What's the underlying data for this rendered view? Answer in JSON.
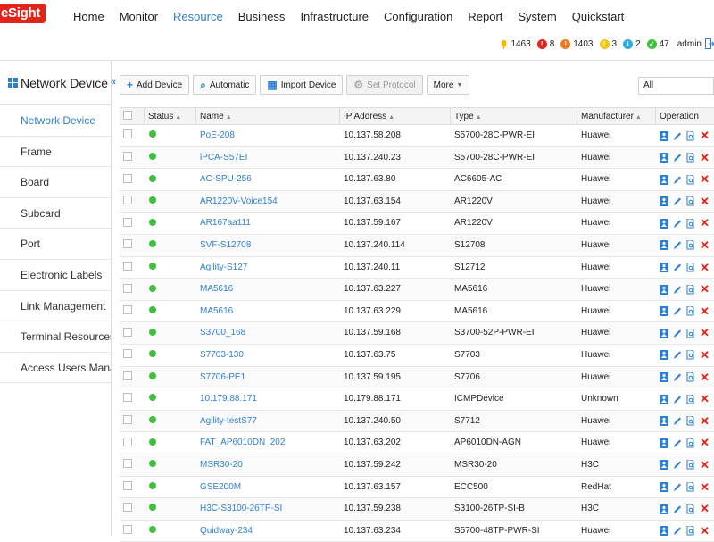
{
  "app": {
    "logo_text": "eSight",
    "nav": [
      {
        "label": "Home",
        "active": false
      },
      {
        "label": "Monitor",
        "active": false
      },
      {
        "label": "Resource",
        "active": true
      },
      {
        "label": "Business",
        "active": false
      },
      {
        "label": "Infrastructure",
        "active": false
      },
      {
        "label": "Configuration",
        "active": false
      },
      {
        "label": "Report",
        "active": false
      },
      {
        "label": "System",
        "active": false
      },
      {
        "label": "Quickstart",
        "active": false
      }
    ],
    "alarms": {
      "total": "1463",
      "critical": "8",
      "major": "1403",
      "minor": "3",
      "warning": "2",
      "cleared": "47"
    },
    "user": "admin"
  },
  "sidebar": {
    "title": "Network Device",
    "collapse_icon": "«",
    "items": [
      {
        "label": "Network Device",
        "active": true
      },
      {
        "label": "Frame",
        "active": false
      },
      {
        "label": "Board",
        "active": false
      },
      {
        "label": "Subcard",
        "active": false
      },
      {
        "label": "Port",
        "active": false
      },
      {
        "label": "Electronic Labels",
        "active": false
      },
      {
        "label": "Link Management",
        "active": false
      },
      {
        "label": "Terminal Resources",
        "active": false
      },
      {
        "label": "Access Users Manage...",
        "active": false
      }
    ]
  },
  "toolbar": {
    "add_device": "Add Device",
    "automatic": "Automatic",
    "import_device": "Import Device",
    "set_protocol": "Set Protocol",
    "more": "More",
    "filter_value": "All"
  },
  "table": {
    "headers": {
      "status": "Status",
      "name": "Name",
      "ip": "IP Address",
      "type": "Type",
      "manufacturer": "Manufacturer",
      "operation": "Operation"
    },
    "rows": [
      {
        "name": "PoE-208",
        "ip": "10.137.58.208",
        "type": "S5700-28C-PWR-EI",
        "manufacturer": "Huawei"
      },
      {
        "name": "iPCA-S57EI",
        "ip": "10.137.240.23",
        "type": "S5700-28C-PWR-EI",
        "manufacturer": "Huawei"
      },
      {
        "name": "AC-SPU-256",
        "ip": "10.137.63.80",
        "type": "AC6605-AC",
        "manufacturer": "Huawei"
      },
      {
        "name": "AR1220V-Voice154",
        "ip": "10.137.63.154",
        "type": "AR1220V",
        "manufacturer": "Huawei"
      },
      {
        "name": "AR167aa111",
        "ip": "10.137.59.167",
        "type": "AR1220V",
        "manufacturer": "Huawei"
      },
      {
        "name": "SVF-S12708",
        "ip": "10.137.240.114",
        "type": "S12708",
        "manufacturer": "Huawei"
      },
      {
        "name": "Agility-S127",
        "ip": "10.137.240.11",
        "type": "S12712",
        "manufacturer": "Huawei"
      },
      {
        "name": "MA5616",
        "ip": "10.137.63.227",
        "type": "MA5616",
        "manufacturer": "Huawei"
      },
      {
        "name": "MA5616",
        "ip": "10.137.63.229",
        "type": "MA5616",
        "manufacturer": "Huawei"
      },
      {
        "name": "S3700_168",
        "ip": "10.137.59.168",
        "type": "S3700-52P-PWR-EI",
        "manufacturer": "Huawei"
      },
      {
        "name": "S7703-130",
        "ip": "10.137.63.75",
        "type": "S7703",
        "manufacturer": "Huawei"
      },
      {
        "name": "S7706-PE1",
        "ip": "10.137.59.195",
        "type": "S7706",
        "manufacturer": "Huawei"
      },
      {
        "name": "10.179.88.171",
        "ip": "10.179.88.171",
        "type": "ICMPDevice",
        "manufacturer": "Unknown"
      },
      {
        "name": "Agility-testS77",
        "ip": "10.137.240.50",
        "type": "S7712",
        "manufacturer": "Huawei"
      },
      {
        "name": "FAT_AP6010DN_202",
        "ip": "10.137.63.202",
        "type": "AP6010DN-AGN",
        "manufacturer": "Huawei"
      },
      {
        "name": "MSR30-20",
        "ip": "10.137.59.242",
        "type": "MSR30-20",
        "manufacturer": "H3C"
      },
      {
        "name": "GSE200M",
        "ip": "10.137.63.157",
        "type": "ECC500",
        "manufacturer": "RedHat"
      },
      {
        "name": "H3C-S3100-26TP-SI",
        "ip": "10.137.59.238",
        "type": "S3100-26TP-SI-B",
        "manufacturer": "H3C"
      },
      {
        "name": "Quidway-234",
        "ip": "10.137.63.234",
        "type": "S5700-48TP-PWR-SI",
        "manufacturer": "Huawei"
      }
    ]
  },
  "icons": {
    "status_online": "green-circle",
    "op_detail": "device-detail-icon",
    "op_edit": "pencil-icon",
    "op_config": "document-search-icon",
    "op_delete": "red-x-icon"
  },
  "colors": {
    "accent": "#2f7fd0",
    "logo": "#e1251b",
    "online": "#3fbf3a",
    "delete": "#e1251b"
  }
}
